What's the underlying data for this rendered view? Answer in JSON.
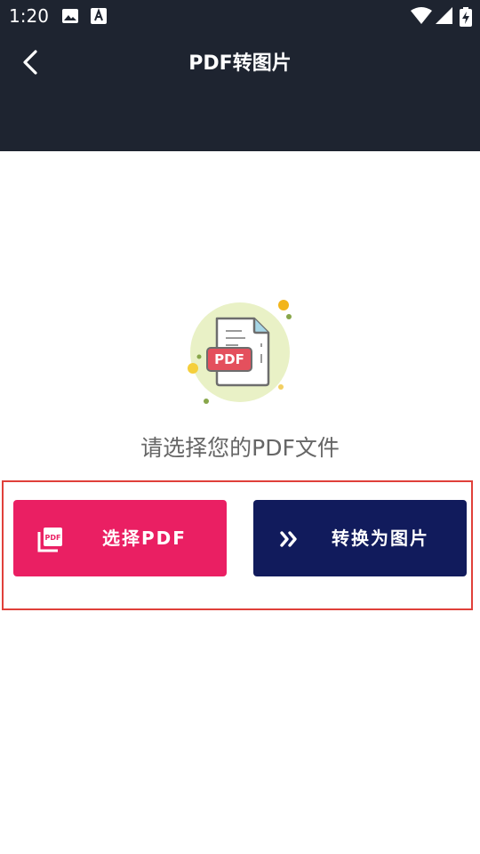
{
  "status_bar": {
    "time": "1:20",
    "icons": [
      "image-icon",
      "font-a-icon",
      "wifi-icon",
      "signal-icon",
      "battery-charging-icon"
    ]
  },
  "app_bar": {
    "back_icon": "chevron-left-icon",
    "title": "PDF转图片"
  },
  "main": {
    "illustration": {
      "icon": "pdf-document-icon",
      "badge_text": "PDF"
    },
    "prompt": "请选择您的PDF文件",
    "buttons": {
      "select_label": "选择PDF",
      "select_icon": "pdf-file-icon",
      "convert_label": "转换为图片",
      "convert_icon": "double-chevron-right-icon"
    }
  },
  "colors": {
    "app_bar_bg": "#1e2430",
    "select_button_bg": "#ea1f63",
    "convert_button_bg": "#111b5c",
    "highlight_border": "#e0403a"
  }
}
